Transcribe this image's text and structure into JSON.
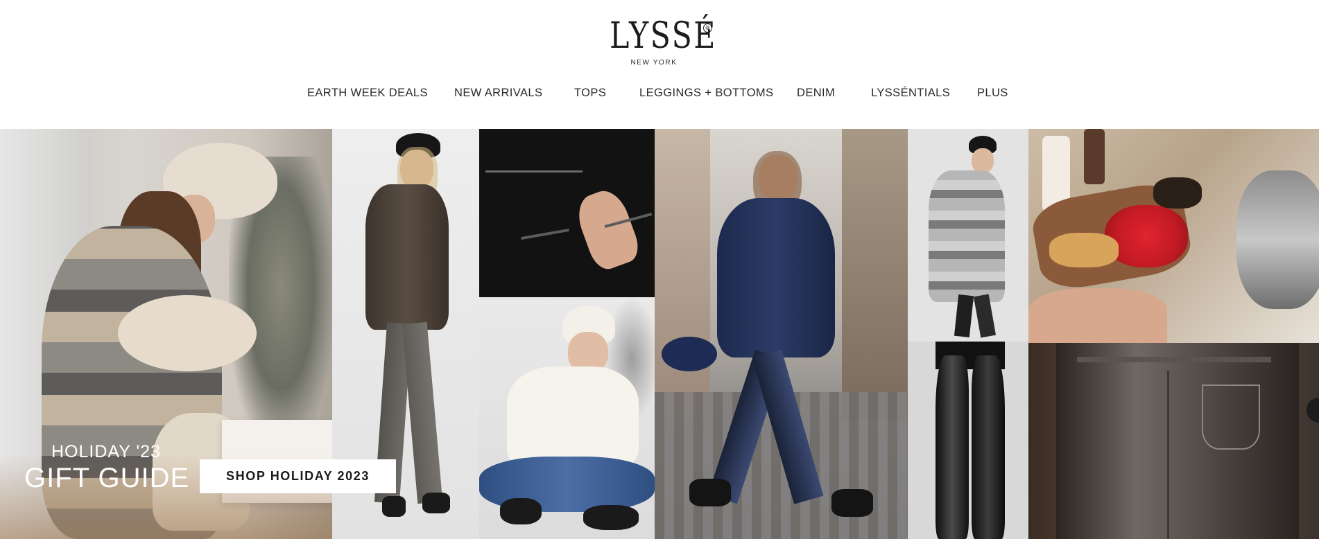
{
  "brand": {
    "name": "LYSSÉ",
    "registered": "®",
    "subtitle": "NEW YORK"
  },
  "nav": {
    "items": [
      {
        "label": "EARTH WEEK DEALS"
      },
      {
        "label": "NEW ARRIVALS"
      },
      {
        "label": "TOPS"
      },
      {
        "label": "LEGGINGS + BOTTOMS"
      },
      {
        "label": "DENIM"
      },
      {
        "label": "LYSSÉNTIALS"
      },
      {
        "label": "PLUS"
      }
    ]
  },
  "hero": {
    "eyebrow": "HOLIDAY '23",
    "headline": "GIFT GUIDE",
    "cta_label": "SHOP HOLIDAY 2023"
  },
  "colors": {
    "text": "#222222",
    "cta_background": "#ffffff",
    "overlay_text": "#ffffff"
  },
  "icons": {
    "chat": "chat-icon"
  }
}
